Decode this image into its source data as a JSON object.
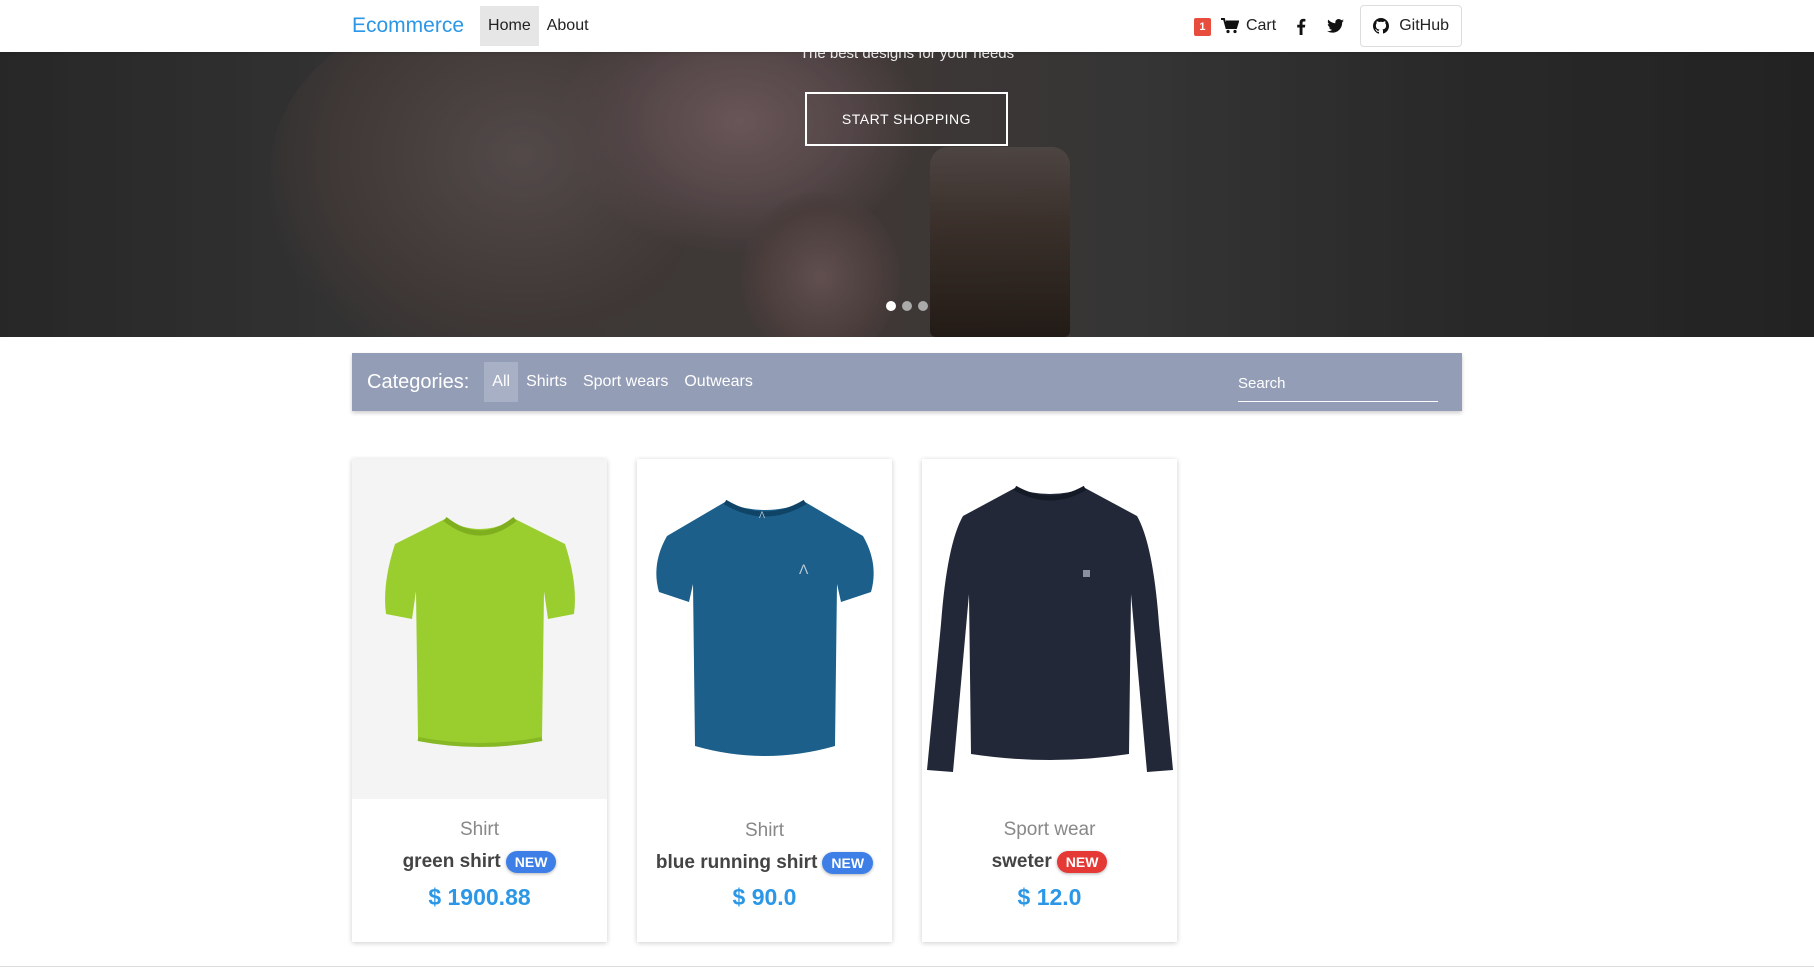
{
  "navbar": {
    "brand": "Ecommerce",
    "links": [
      "Home",
      "About"
    ],
    "cart_count": "1",
    "cart_label": "Cart",
    "github_label": "GitHub"
  },
  "hero": {
    "subtitle": "The best designs for your needs",
    "button_label": "START SHOPPING",
    "slides": 3,
    "active_slide": 1
  },
  "categories": {
    "title": "Categories:",
    "items": [
      "All",
      "Shirts",
      "Sport wears",
      "Outwears"
    ],
    "active": "All",
    "search_placeholder": "Search"
  },
  "products": [
    {
      "category": "Shirt",
      "name": "green shirt",
      "badge": "NEW",
      "badge_color": "#3d7fe6",
      "price": "$ 1900.88",
      "shirt_color": "#9acd2e",
      "image": "green-tshirt"
    },
    {
      "category": "Shirt",
      "name": "blue running shirt",
      "badge": "NEW",
      "badge_color": "#3d7fe6",
      "price": "$ 90.0",
      "shirt_color": "#1b5f8a",
      "image": "blue-tshirt"
    },
    {
      "category": "Sport wear",
      "name": "sweter",
      "badge": "NEW",
      "badge_color": "#e53935",
      "price": "$ 12.0",
      "shirt_color": "#222838",
      "image": "navy-longsleeve"
    }
  ],
  "colors": {
    "accent": "#2b97e6",
    "catbar": "#939db6",
    "cart_badge": "#e74c3c"
  }
}
